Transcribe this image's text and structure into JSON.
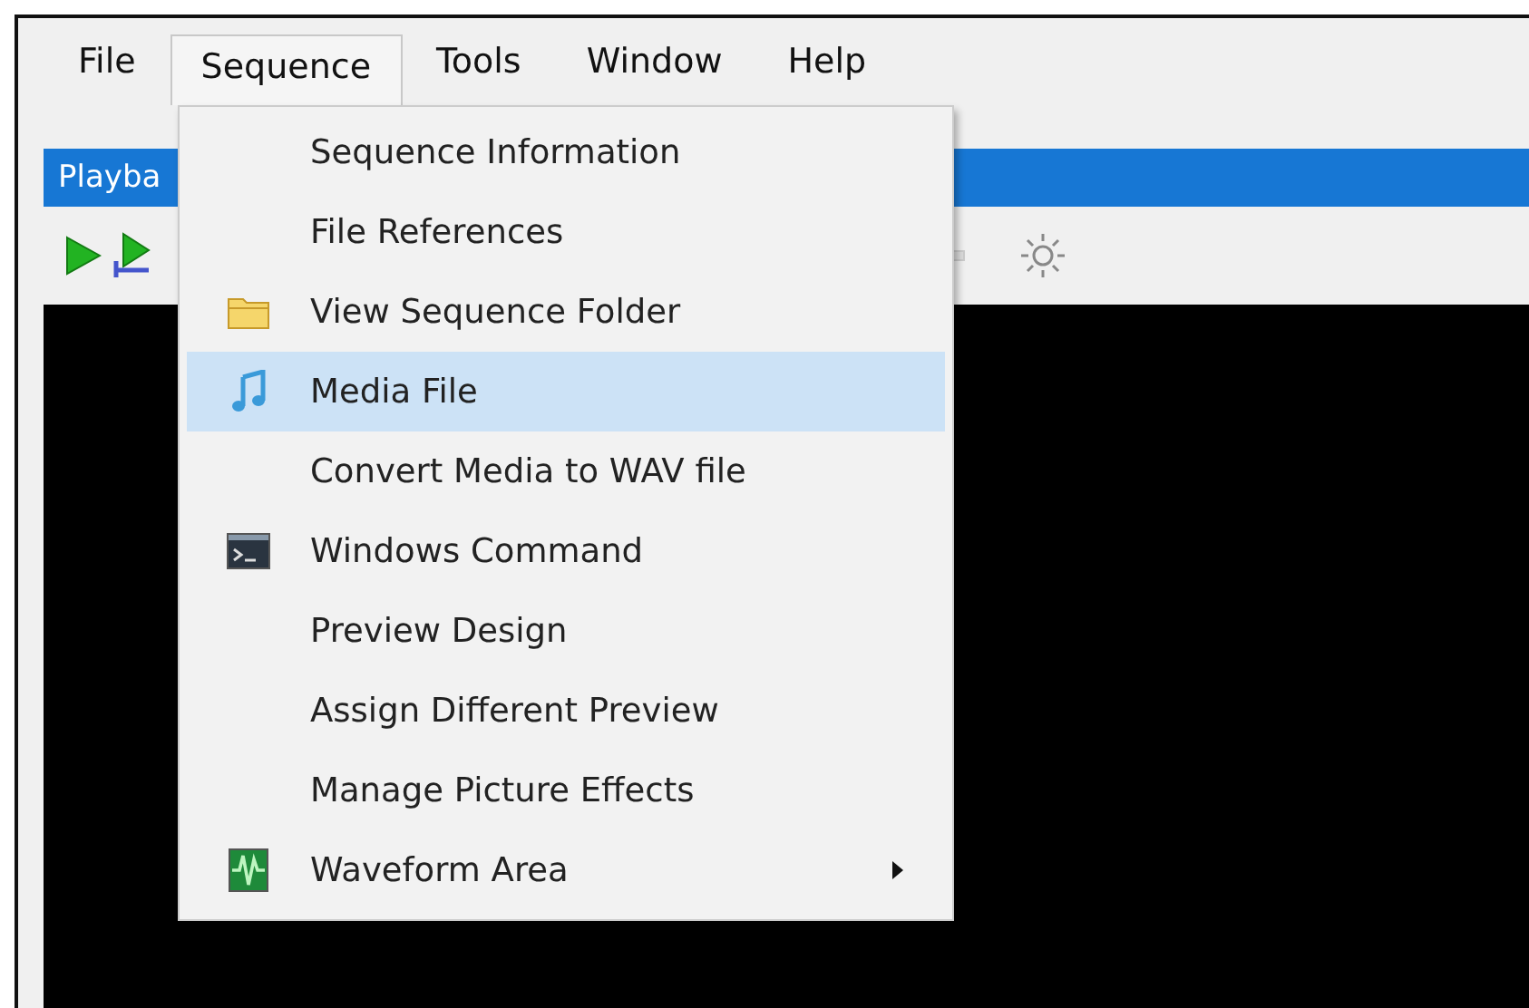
{
  "menu_bar": [
    {
      "label": "File",
      "selected": false
    },
    {
      "label": "Sequence",
      "selected": true
    },
    {
      "label": "Tools",
      "selected": false
    },
    {
      "label": "Window",
      "selected": false
    },
    {
      "label": "Help",
      "selected": false
    }
  ],
  "panel": {
    "title": "Playba"
  },
  "dropdown": {
    "items": [
      {
        "label": "Sequence Information",
        "selected": false
      },
      {
        "label": "File References",
        "selected": false
      },
      {
        "label": "View Sequence Folder",
        "kind": "folder",
        "selected": false
      },
      {
        "label": "Media File",
        "kind": "note",
        "selected": true
      },
      {
        "label": "Convert Media to WAV file",
        "selected": false
      },
      {
        "label": "Windows Command",
        "kind": "command",
        "selected": false
      },
      {
        "label": "Preview Design",
        "selected": false
      },
      {
        "label": "Assign Different Preview",
        "selected": false
      },
      {
        "label": "Manage Picture Effects",
        "selected": false
      },
      {
        "label": "Waveform Area",
        "kind": "waveform",
        "submenu": true,
        "selected": false
      }
    ]
  }
}
